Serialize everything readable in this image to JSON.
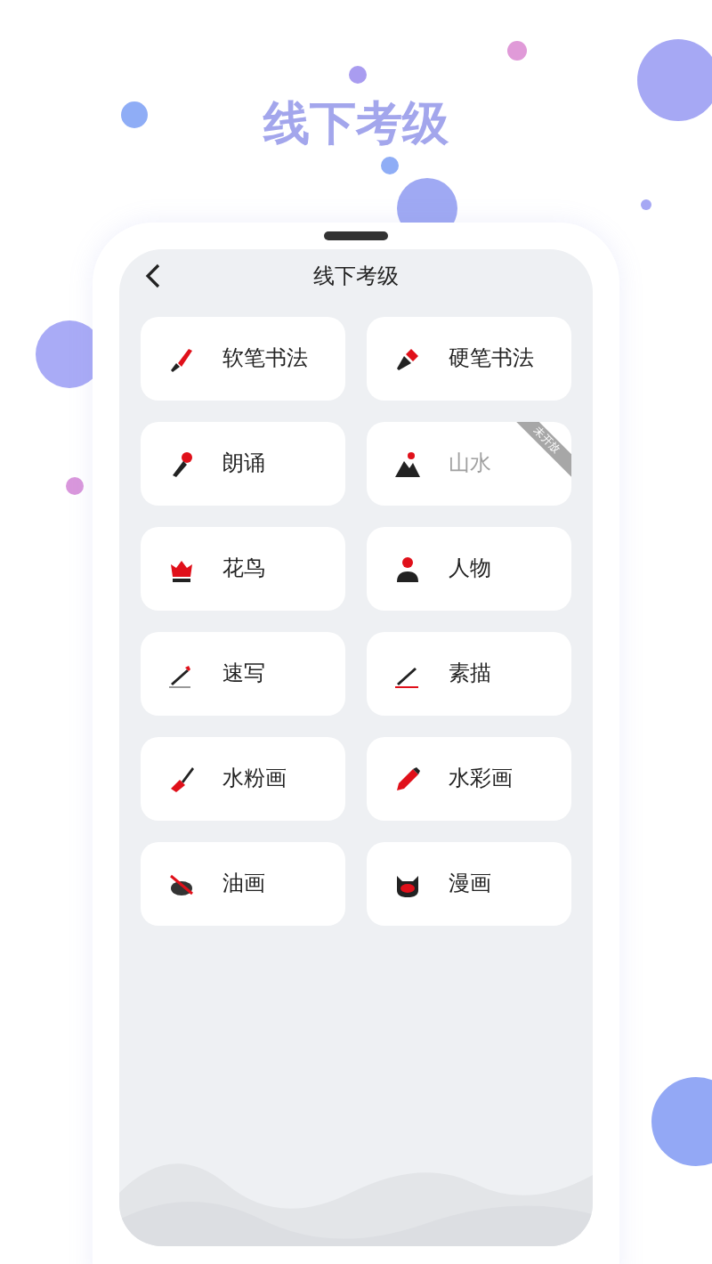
{
  "banner_title": "线下考级",
  "screen": {
    "title": "线下考级",
    "items": [
      {
        "label": "软笔书法",
        "disabled": false
      },
      {
        "label": "硬笔书法",
        "disabled": false
      },
      {
        "label": "朗诵",
        "disabled": false
      },
      {
        "label": "山水",
        "disabled": true,
        "ribbon": "未开放"
      },
      {
        "label": "花鸟",
        "disabled": false
      },
      {
        "label": "人物",
        "disabled": false
      },
      {
        "label": "速写",
        "disabled": false
      },
      {
        "label": "素描",
        "disabled": false
      },
      {
        "label": "水粉画",
        "disabled": false
      },
      {
        "label": "水彩画",
        "disabled": false
      },
      {
        "label": "油画",
        "disabled": false
      },
      {
        "label": "漫画",
        "disabled": false
      }
    ]
  }
}
